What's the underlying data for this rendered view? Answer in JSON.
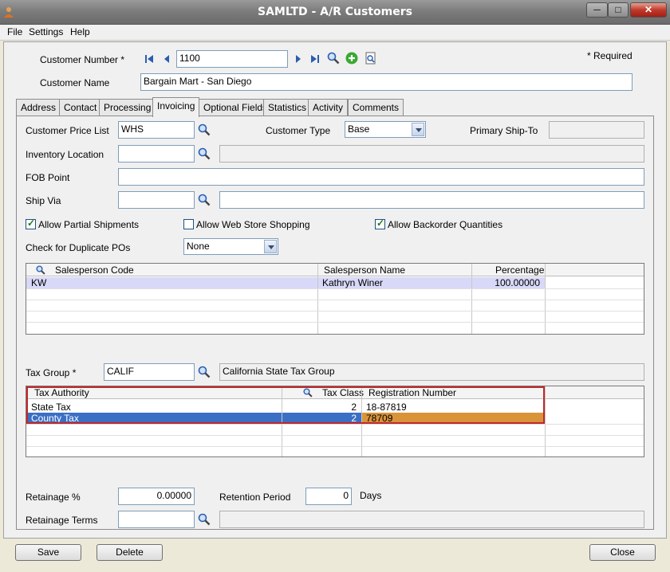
{
  "window": {
    "title": "SAMLTD - A/R Customers",
    "app_icon": "user-icon",
    "minimize": "minimize-icon",
    "maximize": "maximize-icon",
    "close": "close-icon"
  },
  "menu": {
    "items": [
      "File",
      "Settings",
      "Help"
    ]
  },
  "header": {
    "customer_number_label": "Customer Number *",
    "customer_number_value": "1100",
    "required_note": "*   Required",
    "customer_name_label": "Customer Name",
    "customer_name_value": "Bargain Mart - San Diego"
  },
  "tabs": [
    {
      "label": "Address",
      "active": false
    },
    {
      "label": "Contact",
      "active": false
    },
    {
      "label": "Processing",
      "active": false
    },
    {
      "label": "Invoicing",
      "active": true
    },
    {
      "label": "Optional Fields",
      "active": false
    },
    {
      "label": "Statistics",
      "active": false
    },
    {
      "label": "Activity",
      "active": false
    },
    {
      "label": "Comments",
      "active": false
    }
  ],
  "invoicing": {
    "price_list_label": "Customer Price List",
    "price_list_value": "WHS",
    "customer_type_label": "Customer Type",
    "customer_type_value": "Base",
    "primary_ship_to_label": "Primary Ship-To",
    "primary_ship_to_value": "",
    "inventory_location_label": "Inventory Location",
    "inventory_location_value": "",
    "fob_point_label": "FOB Point",
    "fob_point_value": "",
    "ship_via_label": "Ship Via",
    "ship_via_value": "",
    "allow_partial_label": "Allow Partial Shipments",
    "allow_partial_checked": true,
    "allow_web_label": "Allow Web Store Shopping",
    "allow_web_checked": false,
    "allow_backorder_label": "Allow Backorder Quantities",
    "allow_backorder_checked": true,
    "duplicate_po_label": "Check for Duplicate POs",
    "duplicate_po_value": "None"
  },
  "salesperson_grid": {
    "columns": [
      "Salesperson Code",
      "Salesperson Name",
      "Percentage"
    ],
    "rows": [
      {
        "code": "KW",
        "name": "Kathryn Winer",
        "percentage": "100.00000"
      }
    ]
  },
  "tax": {
    "group_label": "Tax Group *",
    "group_value": "CALIF",
    "group_description": "California State Tax Group",
    "columns": [
      "Tax Authority",
      "Tax Class",
      "Registration Number"
    ],
    "rows": [
      {
        "authority": "State Tax",
        "class": "2",
        "registration": "18-87819"
      },
      {
        "authority": "County Tax",
        "class": "2",
        "registration": "78709"
      }
    ]
  },
  "retainage": {
    "percent_label": "Retainage %",
    "percent_value": "0.00000",
    "period_label": "Retention Period",
    "period_value": "0",
    "period_unit": "Days",
    "terms_label": "Retainage Terms",
    "terms_value": "",
    "terms_description": ""
  },
  "buttons": {
    "save": "Save",
    "delete": "Delete",
    "close": "Close"
  },
  "colors": {
    "nav_blue": "#2a5db0",
    "add_green": "#3aa832",
    "selected_row": "#3a6fc4",
    "selected_cell": "#d9943a",
    "lavender_row": "#d8d8f8"
  }
}
